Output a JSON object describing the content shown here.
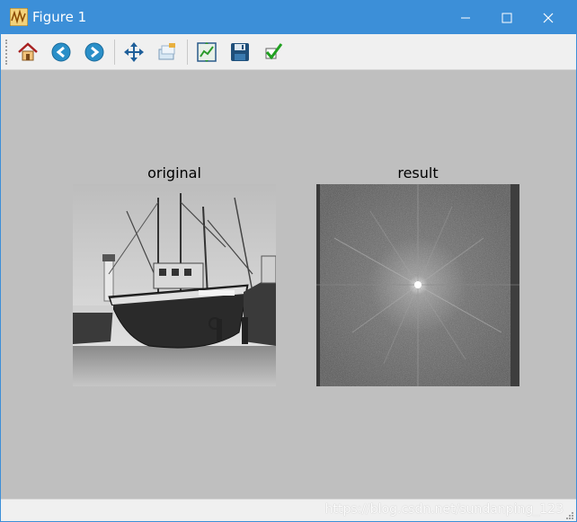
{
  "window": {
    "title": "Figure 1",
    "icon": "matplotlib-figure-icon",
    "controls": {
      "minimize": "minimize-icon",
      "maximize": "maximize-icon",
      "close": "close-icon"
    }
  },
  "toolbar": {
    "buttons": [
      {
        "name": "home-button",
        "icon": "home-icon"
      },
      {
        "name": "back-button",
        "icon": "arrow-left-icon"
      },
      {
        "name": "forward-button",
        "icon": "arrow-right-icon"
      },
      {
        "name": "pan-button",
        "icon": "move-icon"
      },
      {
        "name": "zoom-button",
        "icon": "zoom-rect-icon"
      },
      {
        "name": "subplots-button",
        "icon": "subplots-icon"
      },
      {
        "name": "save-button",
        "icon": "floppy-disk-icon"
      },
      {
        "name": "edit-button",
        "icon": "checkmark-icon"
      }
    ]
  },
  "figure": {
    "subplots": [
      {
        "title": "original",
        "image": "grayscale-boat-photo"
      },
      {
        "title": "result",
        "image": "fourier-magnitude-spectrum"
      }
    ]
  },
  "status": {
    "watermark": "https://blog.csdn.net/sundanping_123"
  },
  "colors": {
    "titlebar": "#3c8fd8",
    "toolbar": "#f0f0f0",
    "canvas": "#bfbfbf"
  }
}
